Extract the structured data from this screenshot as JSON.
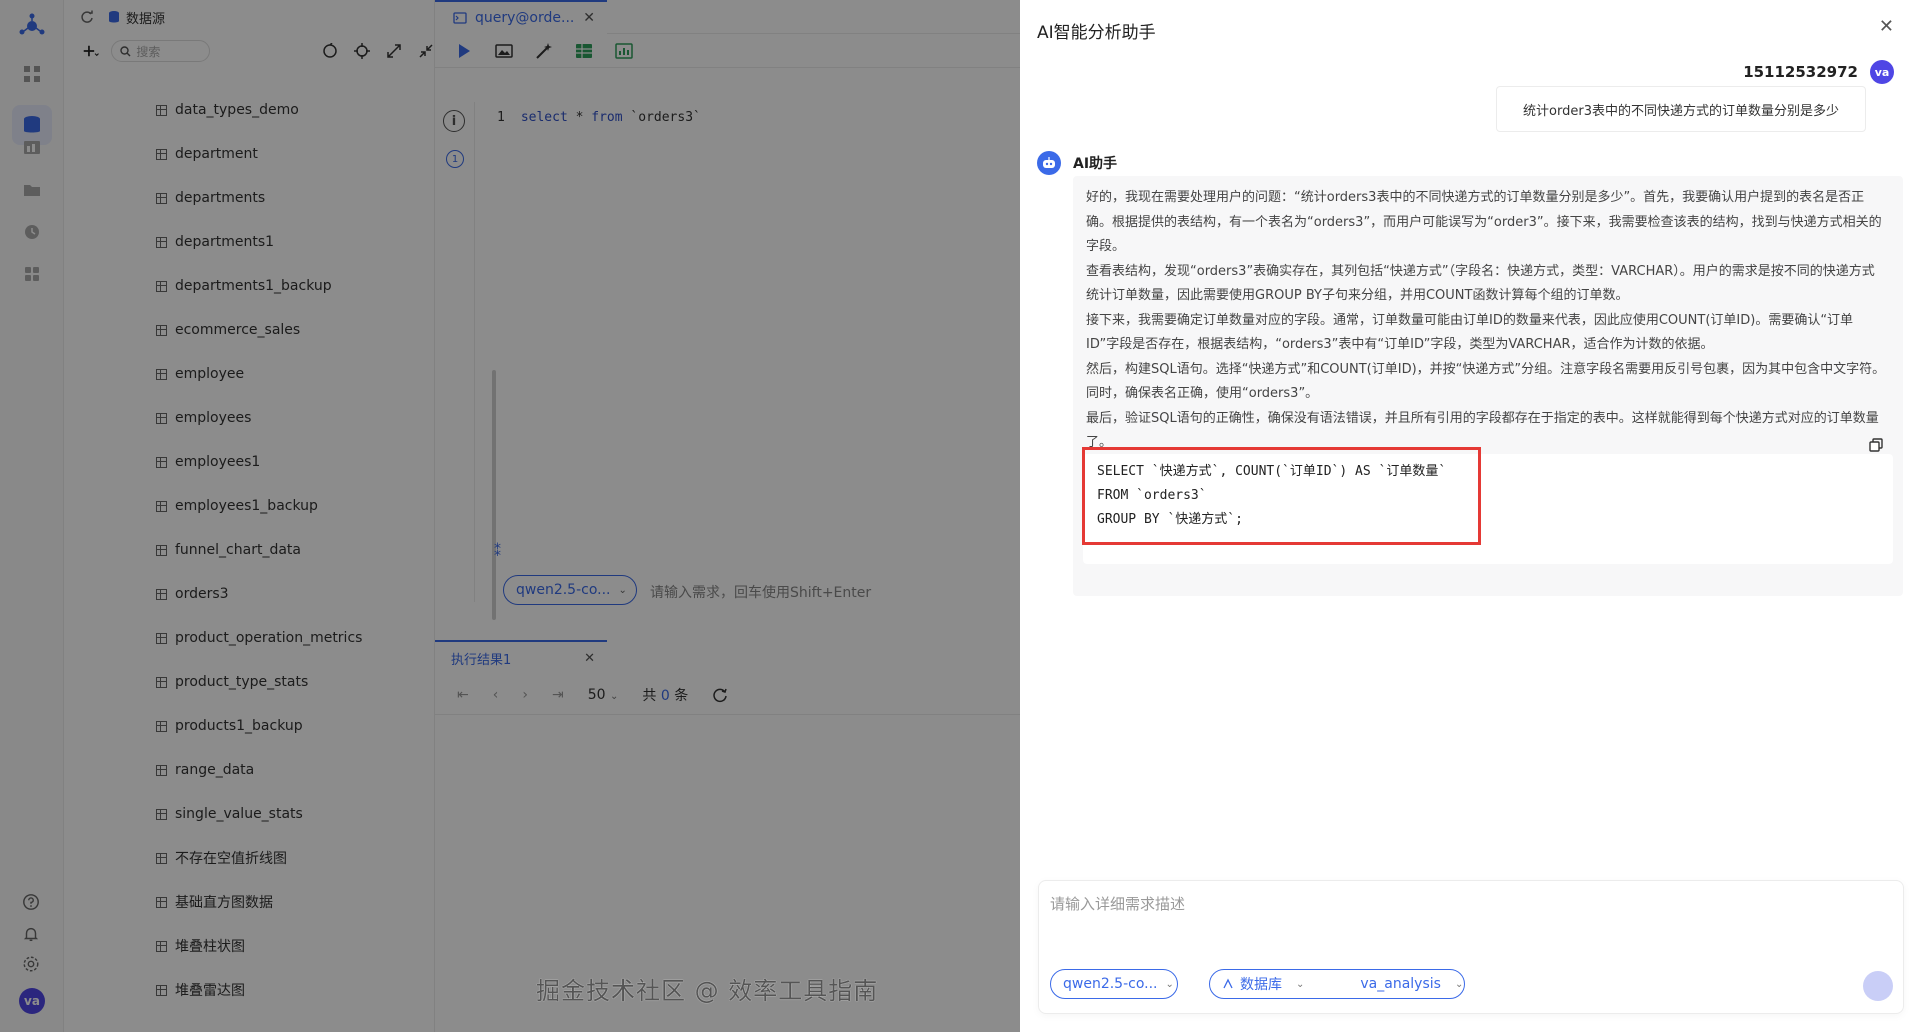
{
  "app": {
    "breadcrumb": "数据源",
    "search_placeholder": "搜索",
    "tables": [
      "data_types_demo",
      "department",
      "departments",
      "departments1",
      "departments1_backup",
      "ecommerce_sales",
      "employee",
      "employees",
      "employees1",
      "employees1_backup",
      "funnel_chart_data",
      "orders3",
      "product_operation_metrics",
      "product_type_stats",
      "products1_backup",
      "range_data",
      "single_value_stats",
      "不存在空值折线图",
      "基础直方图数据",
      "堆叠柱状图",
      "堆叠雷达图"
    ],
    "avatar_initials": "va"
  },
  "editor": {
    "tab_label": "query@orde...",
    "line_number": "1",
    "code_keyword_1": "select",
    "code_star": " * ",
    "code_keyword_2": "from",
    "code_table": " `orders3`",
    "model_chip": "qwen2.5-co...",
    "prompt_hint": "请输入需求，回车使用Shift+Enter"
  },
  "results": {
    "tab_label": "执行结果1",
    "page_size": "50",
    "total_prefix": "共",
    "total_count": "0",
    "total_suffix": "条"
  },
  "drawer": {
    "title": "AI智能分析助手",
    "user_name": "15112532972",
    "user_avatar": "va",
    "user_message": "统计order3表中的不同快递方式的订单数量分别是多少",
    "ai_name": "AI助手",
    "ai_paragraphs": [
      "好的，我现在需要处理用户的问题：“统计orders3表中的不同快递方式的订单数量分别是多少”。首先，我要确认用户提到的表名是否正确。根据提供的表结构，有一个表名为“orders3”，而用户可能误写为“order3”。接下来，我需要检查该表的结构，找到与快递方式相关的字段。",
      "查看表结构，发现“orders3”表确实存在，其列包括“快递方式”（字段名：快递方式，类型：VARCHAR）。用户的需求是按不同的快递方式统计订单数量，因此需要使用GROUP BY子句来分组，并用COUNT函数计算每个组的订单数。",
      "接下来，我需要确定订单数量对应的字段。通常，订单数量可能由订单ID的数量来代表，因此应使用COUNT(订单ID)。需要确认“订单ID”字段是否存在，根据表结构，“orders3”表中有“订单ID”字段，类型为VARCHAR，适合作为计数的依据。",
      "然后，构建SQL语句。选择“快递方式”和COUNT(订单ID)，并按“快递方式”分组。注意字段名需要用反引号包裹，因为其中包含中文字符。同时，确保表名正确，使用“orders3”。",
      "最后，验证SQL语句的正确性，确保没有语法错误，并且所有引用的字段都存在于指定的表中。这样就能得到每个快递方式对应的订单数量了。"
    ],
    "sql_lines": [
      "SELECT `快递方式`, COUNT(`订单ID`) AS `订单数量`",
      "FROM `orders3`",
      "GROUP BY `快递方式`;"
    ],
    "input_placeholder": "请输入详细需求描述",
    "model_chip": "qwen2.5-co...",
    "db_label": "数据库",
    "db_value": "va_analysis"
  },
  "watermark": "掘金技术社区 @ 效率工具指南",
  "colors": {
    "accent": "#3b6ae8",
    "highlight_border": "#e53935",
    "avatar": "#4f46e5"
  }
}
